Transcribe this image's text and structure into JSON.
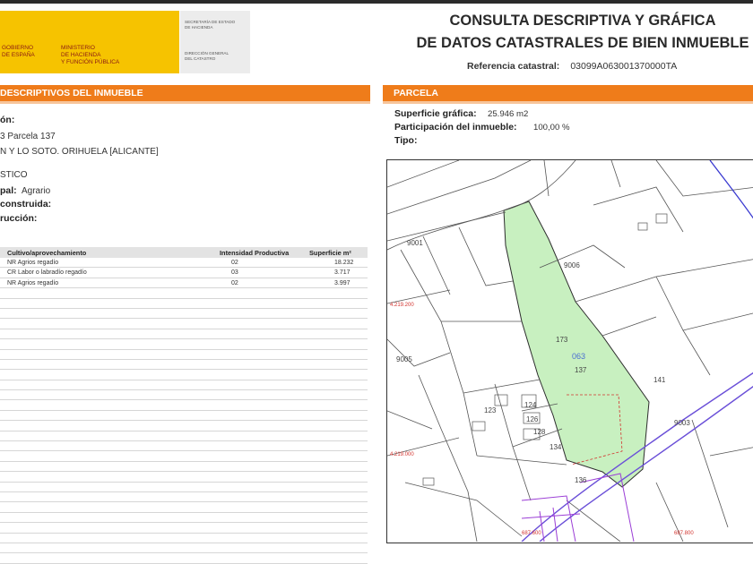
{
  "header": {
    "logo_line1": "GOBIERNO\nDE ESPAÑA",
    "logo_line2": "MINISTERIO\nDE HACIENDA\nY FUNCIÓN PÚBLICA",
    "secretaria": "SECRETARÍA DE ESTADO\nDE HACIENDA",
    "direccion": "DIRECCIÓN GENERAL\nDEL CATASTRO",
    "title_line1": "CONSULTA DESCRIPTIVA Y GRÁFICA",
    "title_line2": "DE DATOS CATASTRALES DE BIEN INMUEBLE",
    "ref_label": "Referencia catastral:",
    "ref_value": "03099A063001370000TA"
  },
  "left": {
    "section_title": "DESCRIPTIVOS DEL INMUEBLE",
    "localizacion_label": "ón:",
    "localizacion_line1": "3 Parcela 137",
    "localizacion_line2": "N Y LO SOTO. ORIHUELA [ALICANTE]",
    "clase_value": "STICO",
    "uso_label": "pal:",
    "uso_value": "Agrario",
    "superficie_label": "construida:",
    "construccion_label": "rucción:"
  },
  "table": {
    "headers": [
      "Cultivo/aprovechamiento",
      "Intensidad Productiva",
      "Superficie m²"
    ],
    "rows": [
      [
        "NR Agrios regadío",
        "02",
        "18.232"
      ],
      [
        "CR Labor o labradío regadío",
        "03",
        "3.717"
      ],
      [
        "NR Agrios regadío",
        "02",
        "3.997"
      ]
    ]
  },
  "parcela": {
    "section_title": "PARCELA",
    "superficie_label": "Superficie gráfica:",
    "superficie_value": "25.946 m2",
    "participacion_label": "Participación del inmueble:",
    "participacion_value": "100,00 %",
    "tipo_label": "Tipo:"
  },
  "map": {
    "highlight_color": "#c8f0c0",
    "labels": {
      "p173": "173",
      "p137": "137",
      "p141": "141",
      "p123": "123",
      "p124": "124",
      "p126": "126",
      "p128": "128",
      "p134": "134",
      "p136": "136",
      "p9001": "9001",
      "p9006": "9006",
      "p9005": "9005",
      "p9003": "9003",
      "pol063": "063",
      "coord1": "4.219.200",
      "coord2": "4.219.000",
      "coord3": "687.600",
      "coord4": "687.800"
    }
  }
}
